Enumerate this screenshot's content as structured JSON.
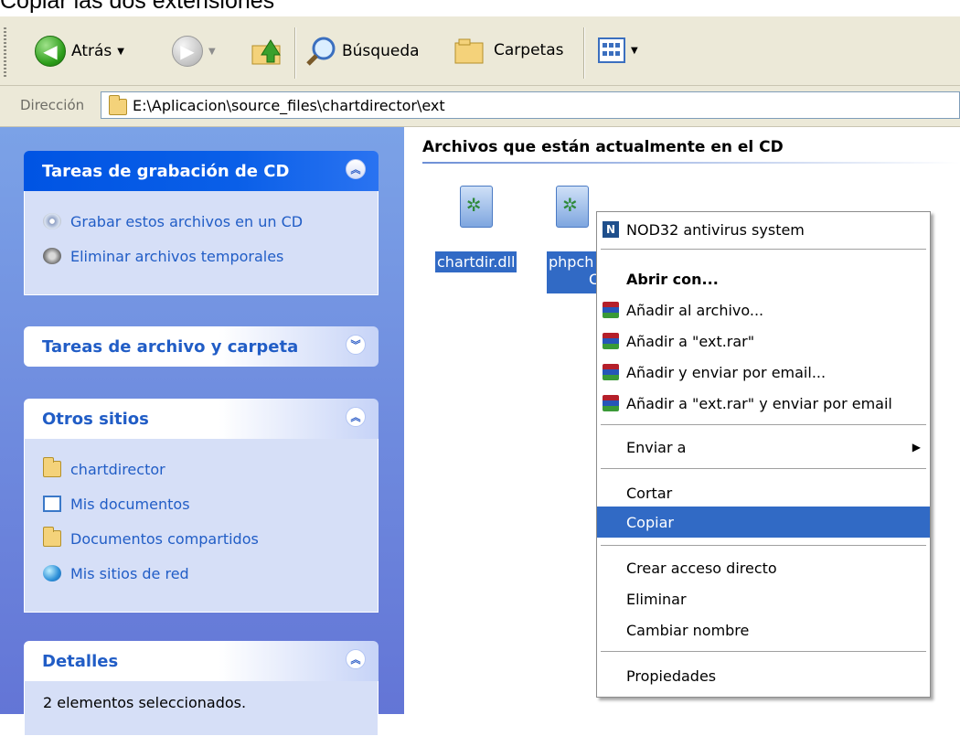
{
  "caption": "Copiar las dos extensiones",
  "toolbar": {
    "back_label": "Atrás",
    "search_label": "Búsqueda",
    "folders_label": "Carpetas"
  },
  "address": {
    "label": "Dirección",
    "path": "E:\\Aplicacion\\source_files\\chartdirector\\ext"
  },
  "sidebar": {
    "cd_tasks": {
      "title": "Tareas de grabación de CD",
      "items": [
        "Grabar estos archivos en un CD",
        "Eliminar archivos temporales"
      ]
    },
    "file_tasks": {
      "title": "Tareas de archivo y carpeta"
    },
    "other_places": {
      "title": "Otros sitios",
      "items": [
        "chartdirector",
        "Mis documentos",
        "Documentos compartidos",
        "Mis sitios de red"
      ]
    },
    "details": {
      "title": "Detalles",
      "text": "2 elementos seleccionados."
    }
  },
  "main": {
    "title": "Archivos que están actualmente en el CD",
    "files": [
      {
        "name": "chartdir.dll"
      },
      {
        "name": "phpch"
      }
    ],
    "partial_char": "C"
  },
  "context_menu": {
    "nod32": "NOD32 antivirus system",
    "open_with": "Abrir con...",
    "add_archive": "Añadir al archivo...",
    "add_ext_rar": "Añadir a \"ext.rar\"",
    "add_send_email": "Añadir y enviar por email...",
    "add_ext_rar_send": "Añadir a \"ext.rar\" y enviar por email",
    "send_to": "Enviar a",
    "cut": "Cortar",
    "copy": "Copiar",
    "create_shortcut": "Crear acceso directo",
    "delete": "Eliminar",
    "rename": "Cambiar nombre",
    "properties": "Propiedades"
  },
  "colors": {
    "selection": "#316ac5",
    "sidebar_top": "#7ba2e7",
    "sidebar_bottom": "#6375d6",
    "link": "#215dc6"
  }
}
